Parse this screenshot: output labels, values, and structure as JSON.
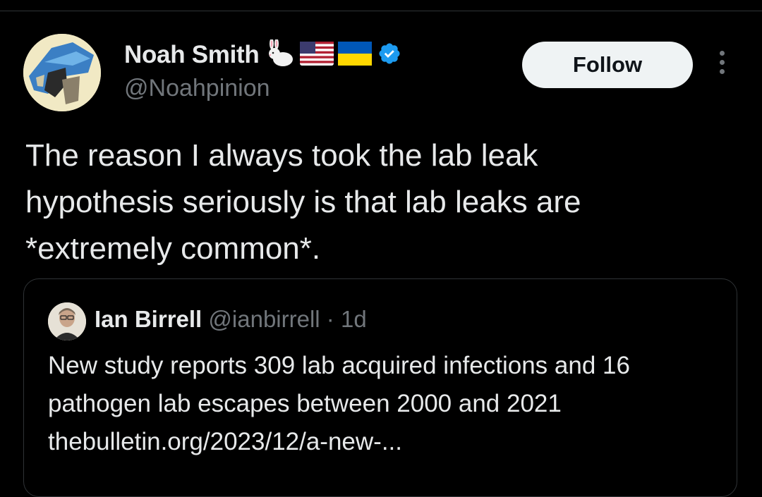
{
  "author": {
    "display_name": "Noah Smith",
    "handle": "@Noahpinion",
    "badges": [
      "rabbit-emoji",
      "us-flag",
      "ukraine-flag",
      "verified-badge"
    ],
    "verified_color": "#1d9bf0"
  },
  "actions": {
    "follow_label": "Follow",
    "more_icon": "more-vertical-icon"
  },
  "tweet": {
    "text": "The reason I always took the lab leak\nhypothesis seriously is that lab leaks are\n*extremely common*."
  },
  "quote": {
    "display_name": "Ian Birrell",
    "handle": "@ianbirrell",
    "separator": "·",
    "time": "1d",
    "text": "New study reports 309 lab acquired infections and 16 pathogen lab escapes between 2000 and 2021 thebulletin.org/2023/12/a-new-..."
  },
  "colors": {
    "background": "#000000",
    "text": "#e7e9ea",
    "secondary": "#71767b",
    "border": "#2f3336",
    "button_bg": "#eff3f4"
  }
}
